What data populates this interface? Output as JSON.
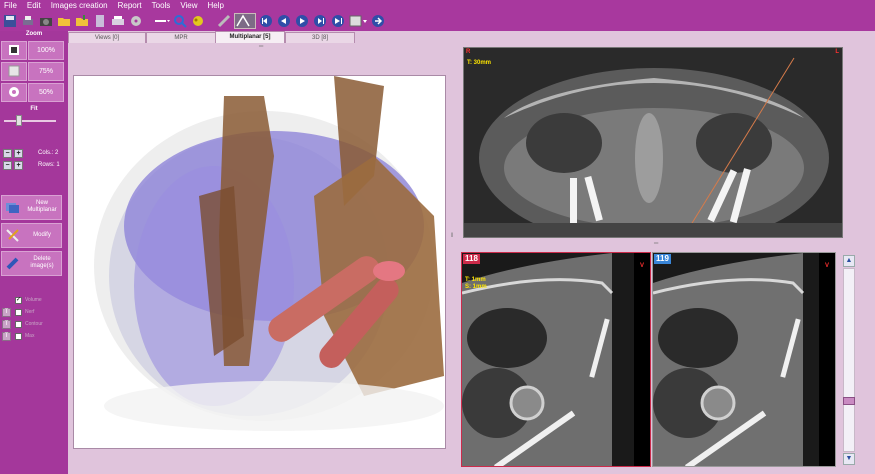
{
  "menu": [
    "File",
    "Edit",
    "Images creation",
    "Report",
    "Tools",
    "View",
    "Help"
  ],
  "toolbar": {
    "icons": [
      "save-icon",
      "print-icon",
      "camera-icon",
      "folder-open-icon",
      "folder-add-icon",
      "document-icon",
      "printer-icon",
      "cd-icon",
      "line-tool-icon",
      "magnifier-icon",
      "brightness-icon",
      "ruler-icon",
      "measure-angle-icon",
      "first-icon",
      "previous-icon",
      "play-icon",
      "next-icon",
      "last-icon",
      "layout-icon",
      "forward-icon"
    ]
  },
  "tabs": [
    {
      "label": "Views [0]"
    },
    {
      "label": "MPR"
    },
    {
      "label": "Multiplanar [5]"
    },
    {
      "label": "3D [8]"
    }
  ],
  "left": {
    "zoom_title": "Zoom",
    "zoom_levels": [
      "100%",
      "75%",
      "50%"
    ],
    "fit_title": "Fit",
    "fit_level": 0.25,
    "cols_label": "Cols.: 2",
    "rows_label": "Rows: 1",
    "new_btn": "New\nMultiplanar",
    "modify_btn": "Modify",
    "delete_btn": "Delete\nimage(s)",
    "layers": [
      {
        "label": "Volume",
        "checked": true
      },
      {
        "label": "Nerf",
        "checked": false
      },
      {
        "label": "Contour",
        "checked": false
      },
      {
        "label": "Max",
        "checked": false
      }
    ]
  },
  "axial": {
    "corner_r": "R",
    "corner_l": "L",
    "thickness": "T: 30mm"
  },
  "slice1": {
    "number": "118",
    "corner": "V",
    "thickness": "T: 1mm",
    "spacing": "S: 1mm"
  },
  "slice2": {
    "number": "119",
    "corner": "V"
  },
  "colors": {
    "accent": "#a4379b",
    "panel": "#e0c4dc",
    "slice_active": "#cc2b4a",
    "slice_idle": "#3a86d8"
  }
}
